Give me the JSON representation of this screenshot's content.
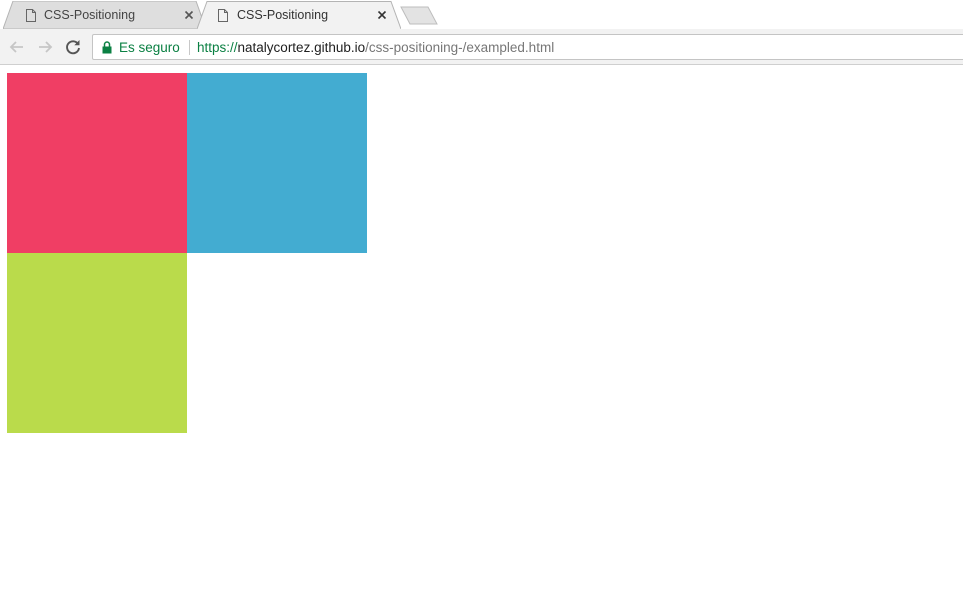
{
  "tabs": [
    {
      "title": "CSS-Positioning",
      "active": false,
      "icon": "document-icon"
    },
    {
      "title": "CSS-Positioning",
      "active": true,
      "icon": "document-icon"
    }
  ],
  "toolbar": {
    "security_label": "Es seguro",
    "url_scheme": "https://",
    "url_host": "natalycortez.github.io",
    "url_path": "/css-positioning-/exampled.html"
  },
  "page": {
    "boxes": [
      {
        "name": "red",
        "color": "#f03e64"
      },
      {
        "name": "blue",
        "color": "#43acd1"
      },
      {
        "name": "green",
        "color": "#badb4b"
      }
    ]
  },
  "colors": {
    "secure_green": "#0b8043",
    "toolbar_bg": "#f2f2f2",
    "inactive_tab_bg": "#dedede",
    "active_tab_bg": "#f2f2f2"
  }
}
